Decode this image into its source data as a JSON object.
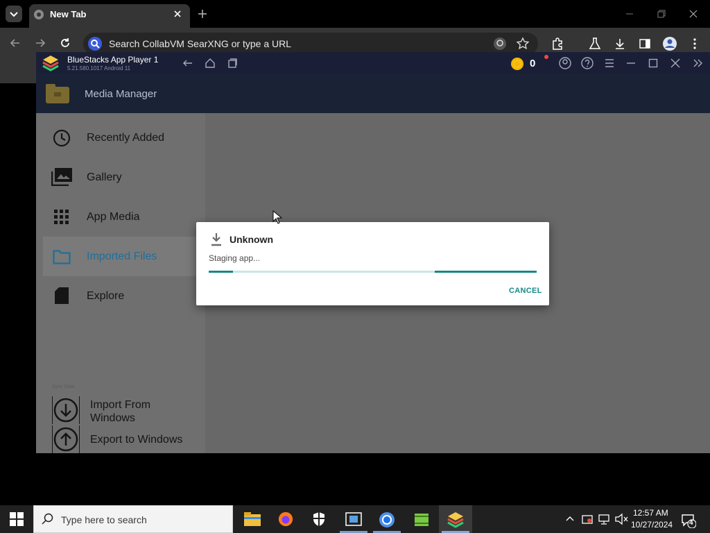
{
  "browser": {
    "tab_title": "New Tab",
    "omnibox_placeholder": "Search CollabVM SearXNG or type a URL"
  },
  "bluestacks": {
    "title": "BlueStacks App Player 1",
    "subtitle": "5.21.580.1017 Android 11",
    "coin_count": "0"
  },
  "media_manager": {
    "title": "Media Manager",
    "sidebar": [
      {
        "label": "Recently Added",
        "icon": "clock-icon"
      },
      {
        "label": "Gallery",
        "icon": "gallery-icon"
      },
      {
        "label": "App Media",
        "icon": "grid-icon"
      },
      {
        "label": "Imported Files",
        "icon": "folder-icon",
        "selected": true
      },
      {
        "label": "Explore",
        "icon": "sd-card-icon"
      }
    ],
    "section_label": "Sync Data",
    "import_label_line1": "Import From",
    "import_label_line2": "Windows",
    "export_label": "Export to Windows"
  },
  "dialog": {
    "title": "Unknown",
    "message": "Staging app...",
    "cancel_label": "CANCEL",
    "accent_color": "#138a87"
  },
  "taskbar": {
    "search_placeholder": "Type here to search",
    "time": "12:57 AM",
    "date": "10/27/2024",
    "notification_count": "4"
  }
}
